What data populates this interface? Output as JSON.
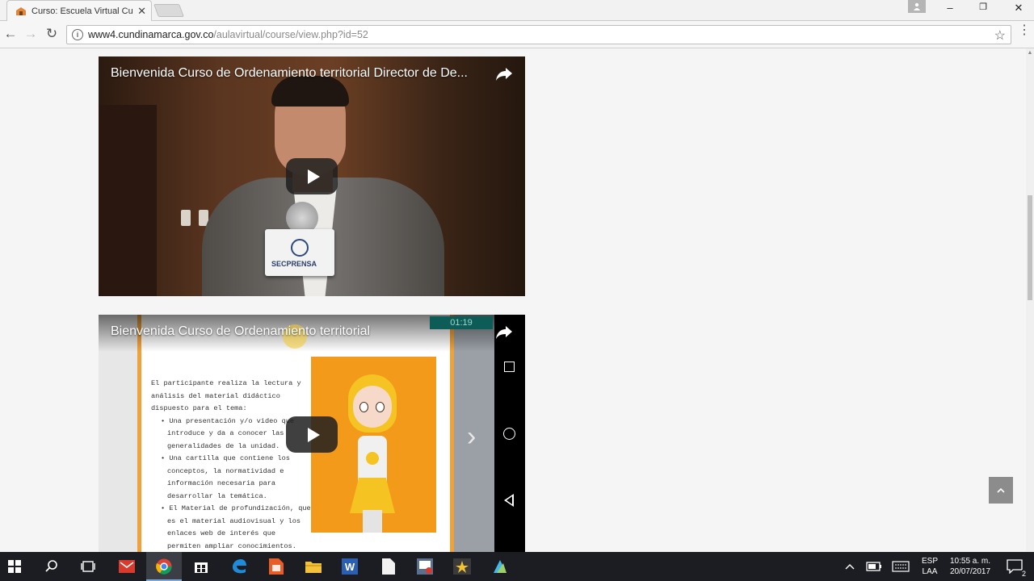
{
  "browser": {
    "tab_title": "Curso: Escuela Virtual Cu",
    "url_host": "www4.cundinamarca.gov.co",
    "url_path": "/aulavirtual/course/view.php?id=52",
    "window_controls": {
      "minimize": "–",
      "maximize": "❐",
      "close": "✕"
    }
  },
  "videos": [
    {
      "title": "Bienvenida Curso de Ordenamiento territorial Director de De...",
      "mic_label": "SECPRENSA"
    },
    {
      "title": "Bienvenida Curso de Ordenamiento territorial",
      "timer": "01:19",
      "slide_intro": "El participante realiza la lectura y análisis del material didáctico dispuesto para el tema:",
      "slide_bullets": [
        "Una presentación y/o video que introduce y da a conocer las generalidades de la unidad.",
        "Una cartilla que contiene los conceptos, la normatividad e información necesaria para desarrollar la temática.",
        "El Material de profundización, que es el material audiovisual y los enlaces web de interés que permiten ampliar conocimientos."
      ]
    }
  ],
  "taskbar": {
    "lang_line1": "ESP",
    "lang_line2": "LAA",
    "time": "10:55 a. m.",
    "date": "20/07/2017",
    "notifications": "2"
  },
  "colors": {
    "accent": "#f0a23a",
    "chrome_bg": "#f2f2f2",
    "taskbar_bg": "#1b1d22"
  }
}
